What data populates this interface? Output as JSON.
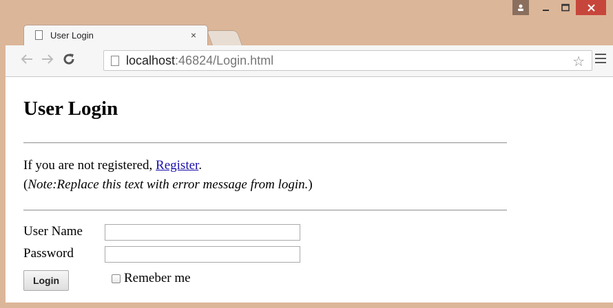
{
  "browser": {
    "tab_title": "User Login",
    "tab_close": "×",
    "url_host": "localhost",
    "url_rest": ":46824/Login.html"
  },
  "page": {
    "heading": "User Login",
    "not_registered_text": "If you are not registered, ",
    "register_link": "Register",
    "period": ".",
    "note_open": "(",
    "note_text": "Note:Replace this text with error message from login.",
    "note_close": ")",
    "form": {
      "username_label": "User Name",
      "username_value": "",
      "password_label": "Password",
      "password_value": "",
      "login_button": "Login",
      "remember_label": "Remeber me",
      "remember_checked": false
    }
  },
  "colors": {
    "frame": "#dcb699",
    "close_button": "#c7463b",
    "link": "#1a0dab"
  }
}
